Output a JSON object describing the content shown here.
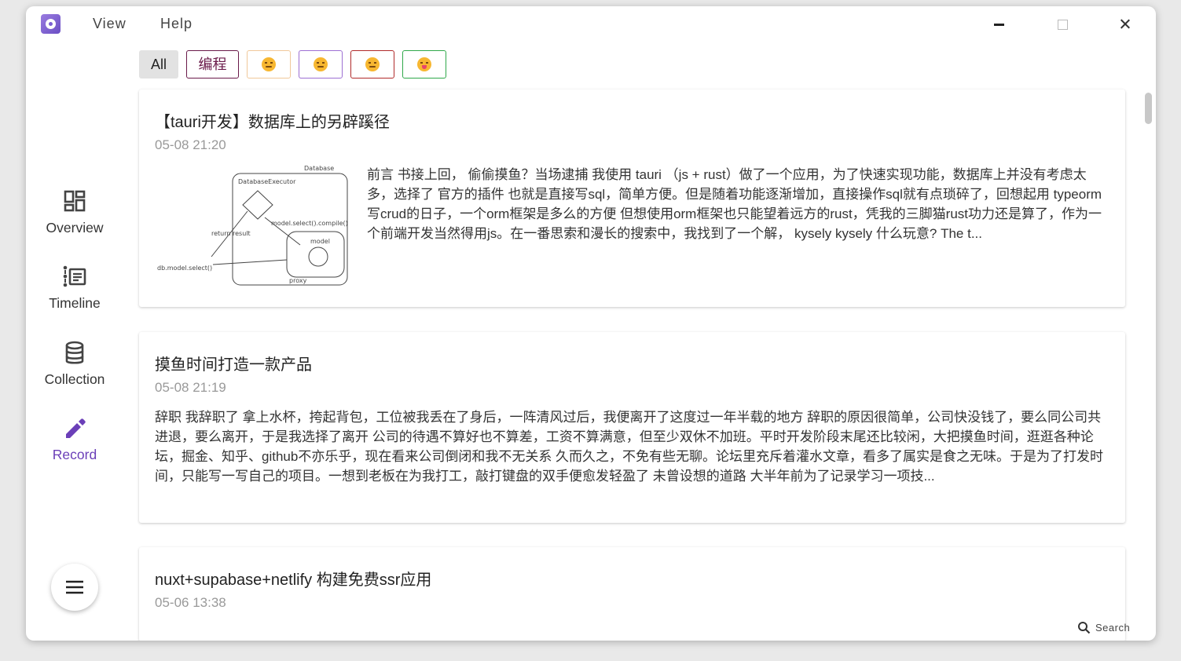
{
  "menu": {
    "view": "View",
    "help": "Help"
  },
  "nav": {
    "overview": "Overview",
    "timeline": "Timeline",
    "collection": "Collection",
    "record": "Record"
  },
  "filters": {
    "all": "All",
    "code": "编程",
    "emoji_1": "sad-face-emoji",
    "emoji_2": "pensive-face-emoji",
    "emoji_3": "expressionless-face-emoji",
    "emoji_4": "winking-tongue-emoji"
  },
  "posts": [
    {
      "title": "【tauri开发】数据库上的另辟蹊径",
      "date": "05-08 21:20",
      "excerpt": "前言 书接上回， 偷偷摸鱼？当场逮捕 我使用 tauri （js + rust）做了一个应用，为了快速实现功能，数据库上并没有考虑太多，选择了 官方的插件 也就是直接写sql，简单方便。但是随着功能逐渐增加，直接操作sql就有点琐碎了，回想起用 typeorm 写crud的日子，一个orm框架是多么的方便 但想使用orm框架也只能望着远方的rust，凭我的三脚猫rust功力还是算了，作为一个前端开发当然得用js。在一番思索和漫长的搜索中，我找到了一个解， kysely kysely 什么玩意? The t...",
      "thumb": {
        "database": "Database",
        "executor": "DatabaseExecutor",
        "compile": "model.select().compile()",
        "return": "return result",
        "model": "model",
        "call": "db.model.select()",
        "proxy": "proxy"
      }
    },
    {
      "title": "摸鱼时间打造一款产品",
      "date": "05-08 21:19",
      "excerpt": "辞职 我辞职了 拿上水杯，挎起背包，工位被我丢在了身后，一阵清风过后，我便离开了这度过一年半载的地方 辞职的原因很简单，公司快没钱了，要么同公司共进退，要么离开，于是我选择了离开 公司的待遇不算好也不算差，工资不算满意，但至少双休不加班。平时开发阶段末尾还比较闲，大把摸鱼时间，逛逛各种论坛，掘金、知乎、github不亦乐乎，现在看来公司倒闭和我不无关系 久而久之，不免有些无聊。论坛里充斥着灌水文章，看多了属实是食之无味。于是为了打发时间，只能写一写自己的项目。一想到老板在为我打工，敲打键盘的双手便愈发轻盈了 未曾设想的道路 大半年前为了记录学习一项技..."
    },
    {
      "title": "nuxt+supabase+netlify 构建免费ssr应用",
      "date": "05-06 13:38"
    }
  ],
  "search": "Search",
  "colors": {
    "accent": "#6b3fb8"
  }
}
